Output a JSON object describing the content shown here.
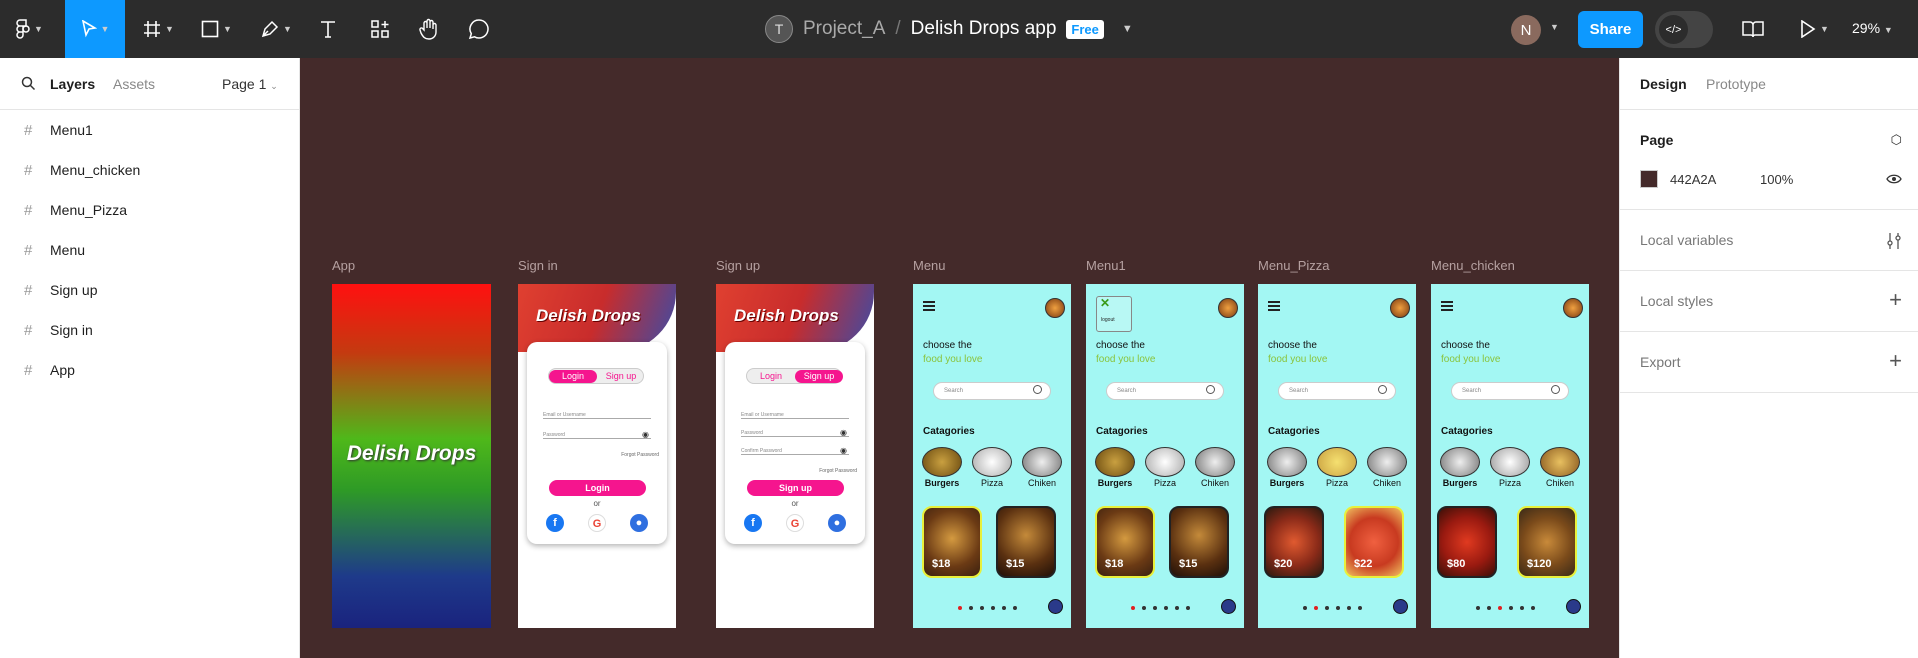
{
  "topbar": {
    "project_initial": "T",
    "project": "Project_A",
    "separator": "/",
    "file": "Delish Drops app",
    "plan_badge": "Free",
    "user_initial": "N",
    "share_label": "Share",
    "zoom": "29%"
  },
  "left": {
    "tab_layers": "Layers",
    "tab_assets": "Assets",
    "page": "Page 1",
    "layers": [
      "Menu1",
      "Menu_chicken",
      "Menu_Pizza",
      "Menu",
      "Sign up",
      "Sign in",
      "App"
    ]
  },
  "right": {
    "tab_design": "Design",
    "tab_prototype": "Prototype",
    "page_title": "Page",
    "page_color": "442A2A",
    "page_opacity": "100%",
    "local_variables": "Local variables",
    "local_styles": "Local styles",
    "export": "Export"
  },
  "frames": {
    "app": {
      "label": "App",
      "title": "Delish Drops"
    },
    "signin": {
      "label": "Sign in",
      "title": "Delish Drops",
      "tab_login": "Login",
      "tab_signup": "Sign up",
      "field1": "Email or Username",
      "field2": "Password",
      "forgot": "Forgot Password",
      "button": "Login",
      "or": "or"
    },
    "signup": {
      "label": "Sign up",
      "title": "Delish Drops",
      "tab_login": "Login",
      "tab_signup": "Sign up",
      "field1": "Email or Username",
      "field2": "Password",
      "field3": "Confirm Password",
      "forgot": "Forgot Password",
      "button": "Sign up",
      "or": "or"
    },
    "menu": {
      "label": "Menu",
      "l1": "choose the",
      "l2": "food you love",
      "search": "Search",
      "cats_title": "Catagories",
      "cats": [
        "Burgers",
        "Pizza",
        "Chiken"
      ],
      "prices": [
        "$18",
        "$15"
      ]
    },
    "menu1": {
      "label": "Menu1",
      "logout": "logout",
      "l1": "choose the",
      "l2": "food you love",
      "search": "Search",
      "cats_title": "Catagories",
      "cats": [
        "Burgers",
        "Pizza",
        "Chiken"
      ],
      "prices": [
        "$18",
        "$15"
      ]
    },
    "menu_pizza": {
      "label": "Menu_Pizza",
      "l1": "choose the",
      "l2": "food you love",
      "search": "Search",
      "cats_title": "Catagories",
      "cats": [
        "Burgers",
        "Pizza",
        "Chiken"
      ],
      "prices": [
        "$20",
        "$22"
      ]
    },
    "menu_chicken": {
      "label": "Menu_chicken",
      "l1": "choose the",
      "l2": "food you love",
      "search": "Search",
      "cats_title": "Catagories",
      "cats": [
        "Burgers",
        "Pizza",
        "Chiken"
      ],
      "prices": [
        "$80",
        "$120"
      ]
    }
  },
  "colors": {
    "canvas": "#442a2a",
    "accent": "#0d99ff",
    "mobile_bg": "#a3f7f3",
    "pink": "#f5158e"
  }
}
